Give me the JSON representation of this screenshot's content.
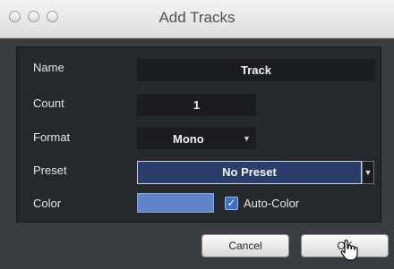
{
  "window": {
    "title": "Add Tracks"
  },
  "form": {
    "name": {
      "label": "Name",
      "value": "Track"
    },
    "count": {
      "label": "Count",
      "value": "1"
    },
    "format": {
      "label": "Format",
      "value": "Mono"
    },
    "preset": {
      "label": "Preset",
      "value": "No Preset"
    },
    "color": {
      "label": "Color",
      "swatch": "#5f84c8",
      "auto_color_label": "Auto-Color",
      "auto_color_checked": true
    }
  },
  "buttons": {
    "cancel": "Cancel",
    "ok": "OK"
  },
  "icons": {
    "window_controls": [
      "close-icon",
      "minimize-icon",
      "zoom-icon"
    ],
    "dropdown": "chevron-down-icon",
    "check": "checkmark-icon",
    "pointer": "hand-pointer-icon"
  },
  "colors": {
    "dialog_background": "#3a3d41",
    "panel_background": "#25282c",
    "field_background": "#1b1d20",
    "preset_highlight": "#2a3d6b"
  }
}
